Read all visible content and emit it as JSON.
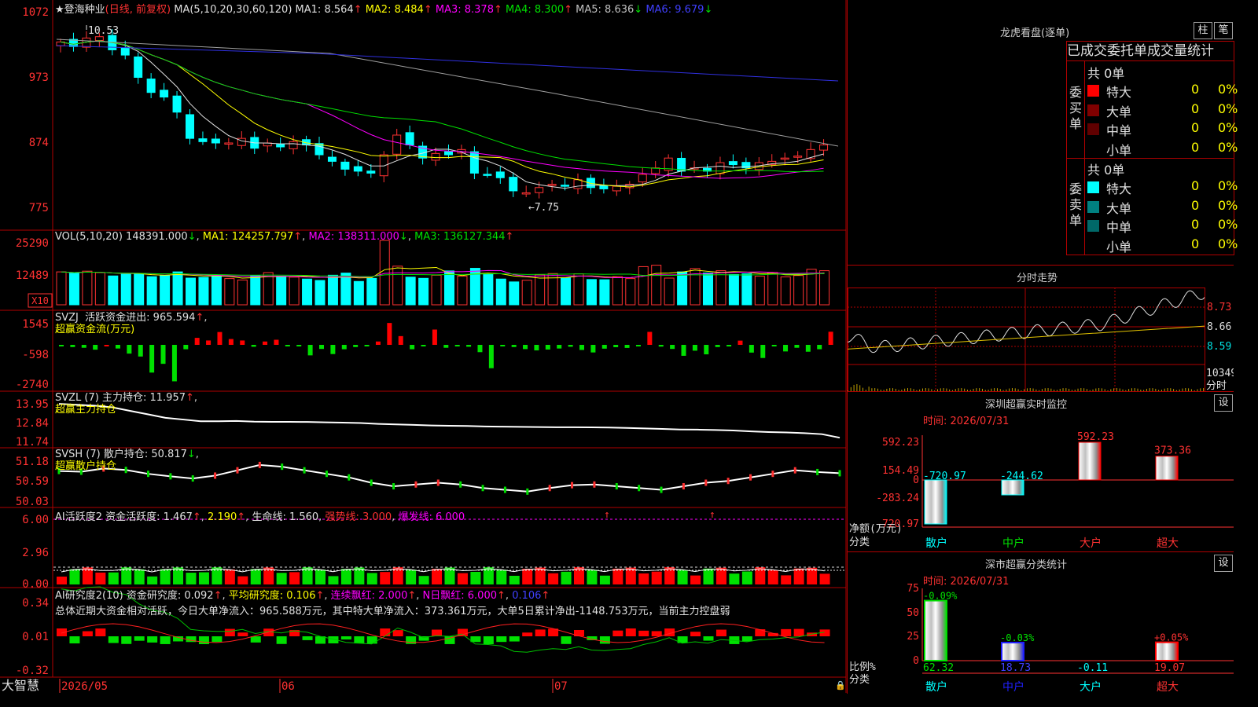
{
  "stock": {
    "name": "登海种业",
    "mode": "(日线, 前复权)",
    "ma_line": "MA(5,10,20,30,60,120)",
    "ma": [
      {
        "label": "MA1:",
        "val": "8.564",
        "arrow": "↑",
        "color": "#e0e0e0"
      },
      {
        "label": "MA2:",
        "val": "8.484",
        "arrow": "↑",
        "color": "#ffff00"
      },
      {
        "label": "MA3:",
        "val": "8.378",
        "arrow": "↑",
        "color": "#ff00ff"
      },
      {
        "label": "MA4:",
        "val": "8.300",
        "arrow": "↑",
        "color": "#00e000"
      },
      {
        "label": "MA5:",
        "val": "8.636",
        "arrow": "↓",
        "color": "#c0c0c0"
      },
      {
        "label": "MA6:",
        "val": "9.679",
        "arrow": "↓",
        "color": "#4040ff"
      }
    ],
    "price_ticks": [
      "1072",
      "973",
      "874",
      "775"
    ],
    "high_label": "10.53",
    "low_label": "←7.75"
  },
  "vol": {
    "title": "VOL(5,10,20)",
    "vol": "148391.000",
    "ma1": "MA1: 124257.797",
    "ma2": "MA2: 138311.000",
    "ma3": "MA3: 136127.344",
    "ticks": [
      "25290",
      "12489"
    ],
    "unit": "X10"
  },
  "svzj": {
    "title": "SVZJ",
    "desc": "活跃资金进出: 965.594",
    "sub": "超赢资金流(万元)",
    "ticks": [
      "1545",
      "-598",
      "-2740"
    ]
  },
  "svzl": {
    "title": "SVZL (7)",
    "desc": "主力持仓: 11.957",
    "sub": "超赢主力持仓",
    "ticks": [
      "13.95",
      "12.84",
      "11.74"
    ]
  },
  "svsh": {
    "title": "SVSH (7)",
    "desc": "散户持仓: 50.817",
    "sub": "超赢散户持仓",
    "ticks": [
      "51.18",
      "50.59",
      "50.03"
    ]
  },
  "ai1": {
    "title": "AI活跃度2",
    "desc": "资金活跃度: 1.467",
    "v2": "2.190",
    "life": "生命线: 1.560",
    "strong": "强势线: 3.000",
    "burst": "爆发线: 6.000",
    "ticks": [
      "6.00",
      "2.96",
      "0.00"
    ]
  },
  "ai2": {
    "title": "AI研究度2(10)",
    "desc": "资金研究度: 0.092",
    "avg": "平均研究度: 0.106",
    "cont": "连续飘红: 2.000",
    "nday": "N日飘红: 6.000",
    "last": "0.106",
    "summary": "总体近期大资金相对活跃，今日大单净流入：965.588万元，其中特大单净流入：373.361万元，大单5日累计净出-1148.753万元，当前主力控盘弱",
    "ticks": [
      "0.34",
      "0.01",
      "-0.32"
    ]
  },
  "bottom": {
    "brand": "大智慧",
    "d1": "2026/05",
    "d2": "06",
    "d3": "07"
  },
  "lhb": {
    "title": "龙虎看盘(逐单)",
    "btn1": "柱",
    "btn2": "笔",
    "header": "已成交委托单成交量统计",
    "buy_label": "委买单",
    "sell_label": "委卖单",
    "buy_total": "共 0单",
    "sell_total": "共 0单",
    "buy": [
      {
        "name": "特大",
        "color": "#ff0000",
        "n": "0",
        "p": "0%"
      },
      {
        "name": "大单",
        "color": "#800000",
        "n": "0",
        "p": "0%"
      },
      {
        "name": "中单",
        "color": "#600000",
        "n": "0",
        "p": "0%"
      },
      {
        "name": "小单",
        "color": "#000000",
        "n": "0",
        "p": "0%"
      }
    ],
    "sell": [
      {
        "name": "特大",
        "color": "#00ffff",
        "n": "0",
        "p": "0%"
      },
      {
        "name": "大单",
        "color": "#008080",
        "n": "0",
        "p": "0%"
      },
      {
        "name": "中单",
        "color": "#006868",
        "n": "0",
        "p": "0%"
      },
      {
        "name": "小单",
        "color": "#000000",
        "n": "0",
        "p": "0%"
      }
    ]
  },
  "fenshi": {
    "title": "分时走势",
    "ticks": [
      "8.73",
      "8.66",
      "8.59"
    ],
    "vol_tick": "10349",
    "label": "分时"
  },
  "sz_monitor": {
    "title": "深圳超赢实时监控",
    "btn": "设",
    "time": "时间: 2026/07/31",
    "ticks": [
      "592.23",
      "154.49",
      "0",
      "-283.24",
      "-720.97"
    ],
    "bars": [
      {
        "cat": "散户",
        "val": -720.97,
        "label": "-720.97"
      },
      {
        "cat": "中户",
        "val": -244.62,
        "label": "-244.62"
      },
      {
        "cat": "大户",
        "val": 592.23,
        "label": "592.23"
      },
      {
        "cat": "超大",
        "val": 373.36,
        "label": "373.36"
      }
    ],
    "ylabel": "净额(万元)",
    "xlabel": "分类"
  },
  "sz_stat": {
    "title": "深市超赢分类统计",
    "btn": "设",
    "time": "时间: 2026/07/31",
    "ticks": [
      "75",
      "50",
      "25",
      "0"
    ],
    "bars": [
      {
        "cat": "散户",
        "val": 62.32,
        "top": "-0.09%",
        "bottom": "62.32"
      },
      {
        "cat": "中户",
        "val": 18.73,
        "top": "-0.03%",
        "bottom": "18.73"
      },
      {
        "cat": "大户",
        "val": -0.11,
        "top": "",
        "bottom": "-0.11"
      },
      {
        "cat": "超大",
        "val": 19.07,
        "top": "+0.05%",
        "bottom": "19.07"
      }
    ],
    "ylabel": "比例%",
    "xlabel": "分类"
  },
  "chart_data": [
    {
      "type": "candlestick",
      "title": "登海种业",
      "ylim": [
        7.6,
        10.8
      ],
      "close": [
        10.32,
        10.25,
        10.38,
        10.4,
        10.2,
        10.12,
        9.78,
        9.55,
        9.48,
        9.25,
        8.85,
        8.8,
        8.78,
        8.78,
        8.85,
        8.7,
        8.78,
        8.72,
        8.8,
        8.75,
        8.6,
        8.5,
        8.38,
        8.35,
        8.32,
        8.6,
        8.9,
        8.75,
        8.55,
        8.62,
        8.6,
        8.68,
        8.32,
        8.3,
        8.25,
        8.05,
        8.02,
        8.1,
        8.15,
        8.12,
        8.22,
        8.1,
        8.08,
        8.12,
        8.15,
        8.3,
        8.4,
        8.55,
        8.35,
        8.4,
        8.35,
        8.48,
        8.45,
        8.4,
        8.48,
        8.5,
        8.55,
        8.58,
        8.68,
        8.75
      ],
      "volume": [
        13800,
        13200,
        14100,
        13500,
        12100,
        12800,
        13000,
        11800,
        12300,
        13800,
        11200,
        11500,
        12000,
        11000,
        10400,
        12200,
        13500,
        12000,
        11600,
        10800,
        10200,
        12400,
        13300,
        9800,
        11100,
        27000,
        16200,
        11600,
        11100,
        12400,
        14200,
        12000,
        15300,
        12700,
        10800,
        9600,
        10300,
        12600,
        13100,
        11300,
        13000,
        10600,
        10500,
        11800,
        11000,
        16000,
        16600,
        11200,
        13800,
        15200,
        13300,
        14300,
        12700,
        13000,
        12000,
        13600,
        11700,
        12300,
        14900,
        14300
      ],
      "svzj": [
        -100,
        -150,
        -200,
        -330,
        0,
        -250,
        -600,
        -800,
        -1900,
        -1300,
        -2500,
        -300,
        480,
        300,
        880,
        400,
        300,
        -130,
        230,
        350,
        -60,
        -100,
        -720,
        -280,
        -630,
        -300,
        -150,
        -100,
        230,
        1500,
        600,
        -300,
        -100,
        1050,
        -200,
        -110,
        -130,
        -500,
        -1600,
        -70,
        -150,
        -290,
        -380,
        -320,
        -250,
        -130,
        -350,
        -520,
        -260,
        -160,
        -210,
        -90,
        890,
        -120,
        -280,
        -750,
        -400,
        -650,
        -150,
        -110,
        290,
        -530,
        -900,
        -100,
        -450,
        -200,
        -470,
        -300,
        900
      ],
      "svzl": [
        13.9,
        13.85,
        13.8,
        13.7,
        13.5,
        13.3,
        13.1,
        13.0,
        12.9,
        12.9,
        12.92,
        12.88,
        12.87,
        12.87,
        12.86,
        12.84,
        12.82,
        12.8,
        12.75,
        12.72,
        12.69,
        12.66,
        12.64,
        12.63,
        12.6,
        12.59,
        12.58,
        12.57,
        12.56,
        12.56,
        12.55,
        12.54,
        12.52,
        12.49,
        12.46,
        12.43,
        12.42,
        12.4,
        12.37,
        12.32,
        12.28,
        12.26,
        12.22,
        12.16,
        11.957
      ],
      "svsh": [
        50.88,
        50.86,
        50.95,
        50.91,
        50.8,
        50.73,
        50.67,
        50.75,
        50.9,
        51.05,
        51.0,
        50.9,
        50.8,
        50.7,
        50.55,
        50.45,
        50.5,
        50.55,
        50.5,
        50.4,
        50.35,
        50.3,
        50.4,
        50.48,
        50.5,
        50.45,
        50.4,
        50.35,
        50.45,
        50.55,
        50.6,
        50.7,
        50.8,
        50.9,
        50.85,
        50.817
      ]
    },
    {
      "type": "bar",
      "title": "深圳超赢实时监控",
      "categories": [
        "散户",
        "中户",
        "大户",
        "超大"
      ],
      "values": [
        -720.97,
        -244.62,
        592.23,
        373.36
      ],
      "ylim": [
        -720.97,
        592.23
      ]
    },
    {
      "type": "bar",
      "title": "深市超赢分类统计",
      "categories": [
        "散户",
        "中户",
        "大户",
        "超大"
      ],
      "values": [
        62.32,
        18.73,
        -0.11,
        19.07
      ],
      "ylim": [
        0,
        75
      ]
    }
  ]
}
